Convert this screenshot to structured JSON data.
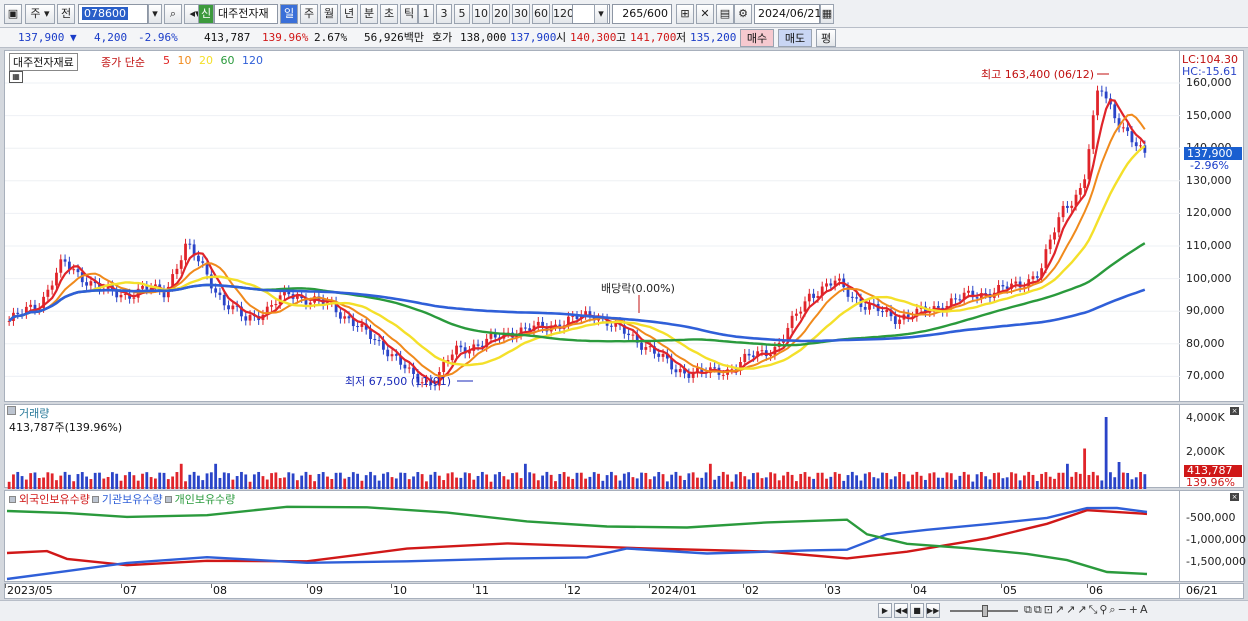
{
  "toolbar": {
    "market": "주",
    "exchange": "전",
    "code": "078600",
    "stock_name": "대주전자재",
    "badge": "신",
    "periods": [
      "일",
      "주",
      "월",
      "년",
      "분",
      "초",
      "틱"
    ],
    "numbers": [
      "1",
      "3",
      "5",
      "10",
      "20",
      "30",
      "60",
      "120"
    ],
    "count": "265",
    "count_max": "/600",
    "date": "2024/06/21"
  },
  "info": {
    "price": "137,900",
    "arrow": "▼",
    "change": "4,200",
    "change_pct": "-2.96%",
    "volume": "413,787",
    "vol_ratio": "139.96%",
    "turnover": "2.67%",
    "amount": "56,926백만",
    "bid_label": "호가",
    "bid": "138,000",
    "ask": "137,900",
    "open_label": "시",
    "open": "140,300",
    "high_label": "고",
    "high": "141,700",
    "low_label": "저",
    "low": "135,200",
    "buy": "매수",
    "sell": "매도",
    "flat": "평"
  },
  "price_panel": {
    "name_box": "대주전자재료",
    "legend_prefix": "종가 단순",
    "ma": [
      {
        "p": "5",
        "c": "#e02020"
      },
      {
        "p": "10",
        "c": "#f08a1c"
      },
      {
        "p": "20",
        "c": "#f4e02a"
      },
      {
        "p": "60",
        "c": "#2a9a3c"
      },
      {
        "p": "120",
        "c": "#2f5fd8"
      }
    ],
    "high_note": "최고 163,400 (06/12)",
    "low_note": "최저 67,500 (11/01)",
    "div_note": "배당락(0.00%)",
    "lc": "LC:104.30",
    "hc": "HC:-15.61",
    "cur_price": "137,900",
    "cur_pct": "-2.96%",
    "yticks": [
      "160,000",
      "150,000",
      "140,000",
      "130,000",
      "120,000",
      "110,000",
      "100,000",
      "90,000",
      "80,000",
      "70,000"
    ]
  },
  "vol_panel": {
    "title": "거래량",
    "sub": "413,787주(139.96%)",
    "yticks": [
      "4,000K",
      "2,000K"
    ],
    "cur": "413,787",
    "cur_pct": "139.96%"
  },
  "hold_panel": {
    "legend": [
      {
        "l": "외국인보유수량",
        "c": "#d01818"
      },
      {
        "l": "기관보유수량",
        "c": "#2f5fd8"
      },
      {
        "l": "개인보유수량",
        "c": "#2a9a3c"
      }
    ],
    "yticks": [
      "-500,000",
      "-1,000,000",
      "-1,500,000"
    ]
  },
  "xaxis": [
    "2023/05",
    "07",
    "08",
    "09",
    "10",
    "11",
    "12",
    "2024/01",
    "02",
    "03",
    "04",
    "05",
    "06"
  ],
  "xaxis_last": "06/21",
  "colors": {
    "up": "#e0242a",
    "down": "#2a44c8",
    "accent": "#1a5fd0"
  }
}
